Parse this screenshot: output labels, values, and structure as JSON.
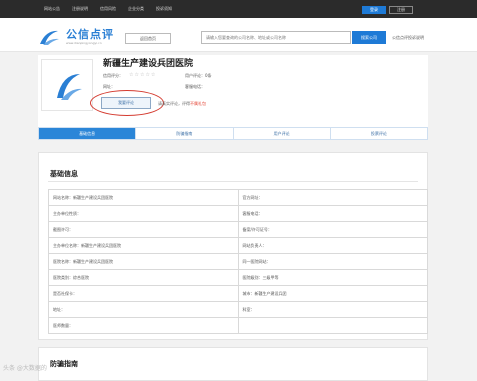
{
  "topbar": {
    "nav": [
      "网站公告",
      "注册说明",
      "信用风险",
      "企业分类",
      "投诉须知"
    ],
    "login_label": "登录",
    "register_label": "注册"
  },
  "header": {
    "logo_text": "公信点评",
    "logo_url": "www.dianpingyongyi.cn",
    "back_label": "返回首页",
    "search_placeholder": "请输入您要查询的公司名称、地址或公司名称",
    "search_button": "搜索公司",
    "side_link": "公信点评投诉说明"
  },
  "company": {
    "name": "新疆生产建设兵团医院",
    "credit_label": "信用评分：",
    "stars": "☆☆☆☆☆",
    "user_review_label": "用户评论：0条",
    "website_label": "网址：",
    "phone_label": "客服电话：",
    "review_button": "我要评论",
    "hint_text": "请真实评论，评得",
    "hint_warn": "不属礼包"
  },
  "tabs": [
    "基础信息",
    "防骗指南",
    "用户评论",
    "投票评论"
  ],
  "basic_info": {
    "title": "基础信息",
    "rows": [
      [
        "网站名称：新疆生产建设兵团医院",
        "官方网址："
      ],
      [
        "主办单位性质：",
        "客服电话："
      ],
      [
        "截图许可：",
        "备案/许可证号："
      ],
      [
        "主办单位名称：新疆生产建设兵团医院",
        "网站负责人："
      ],
      [
        "医院名称：新疆生产建设兵团医院",
        "同一医院网站："
      ],
      [
        "医院类别：综合医院",
        "医院级别：三级甲等"
      ],
      [
        "是否社保卡：",
        "城市：新疆生产建设兵团"
      ],
      [
        "地址：",
        "科室："
      ],
      [
        "医师数量：",
        ""
      ]
    ]
  },
  "guide": {
    "title": "防骗指南"
  },
  "watermark": "头条 @大数据的"
}
